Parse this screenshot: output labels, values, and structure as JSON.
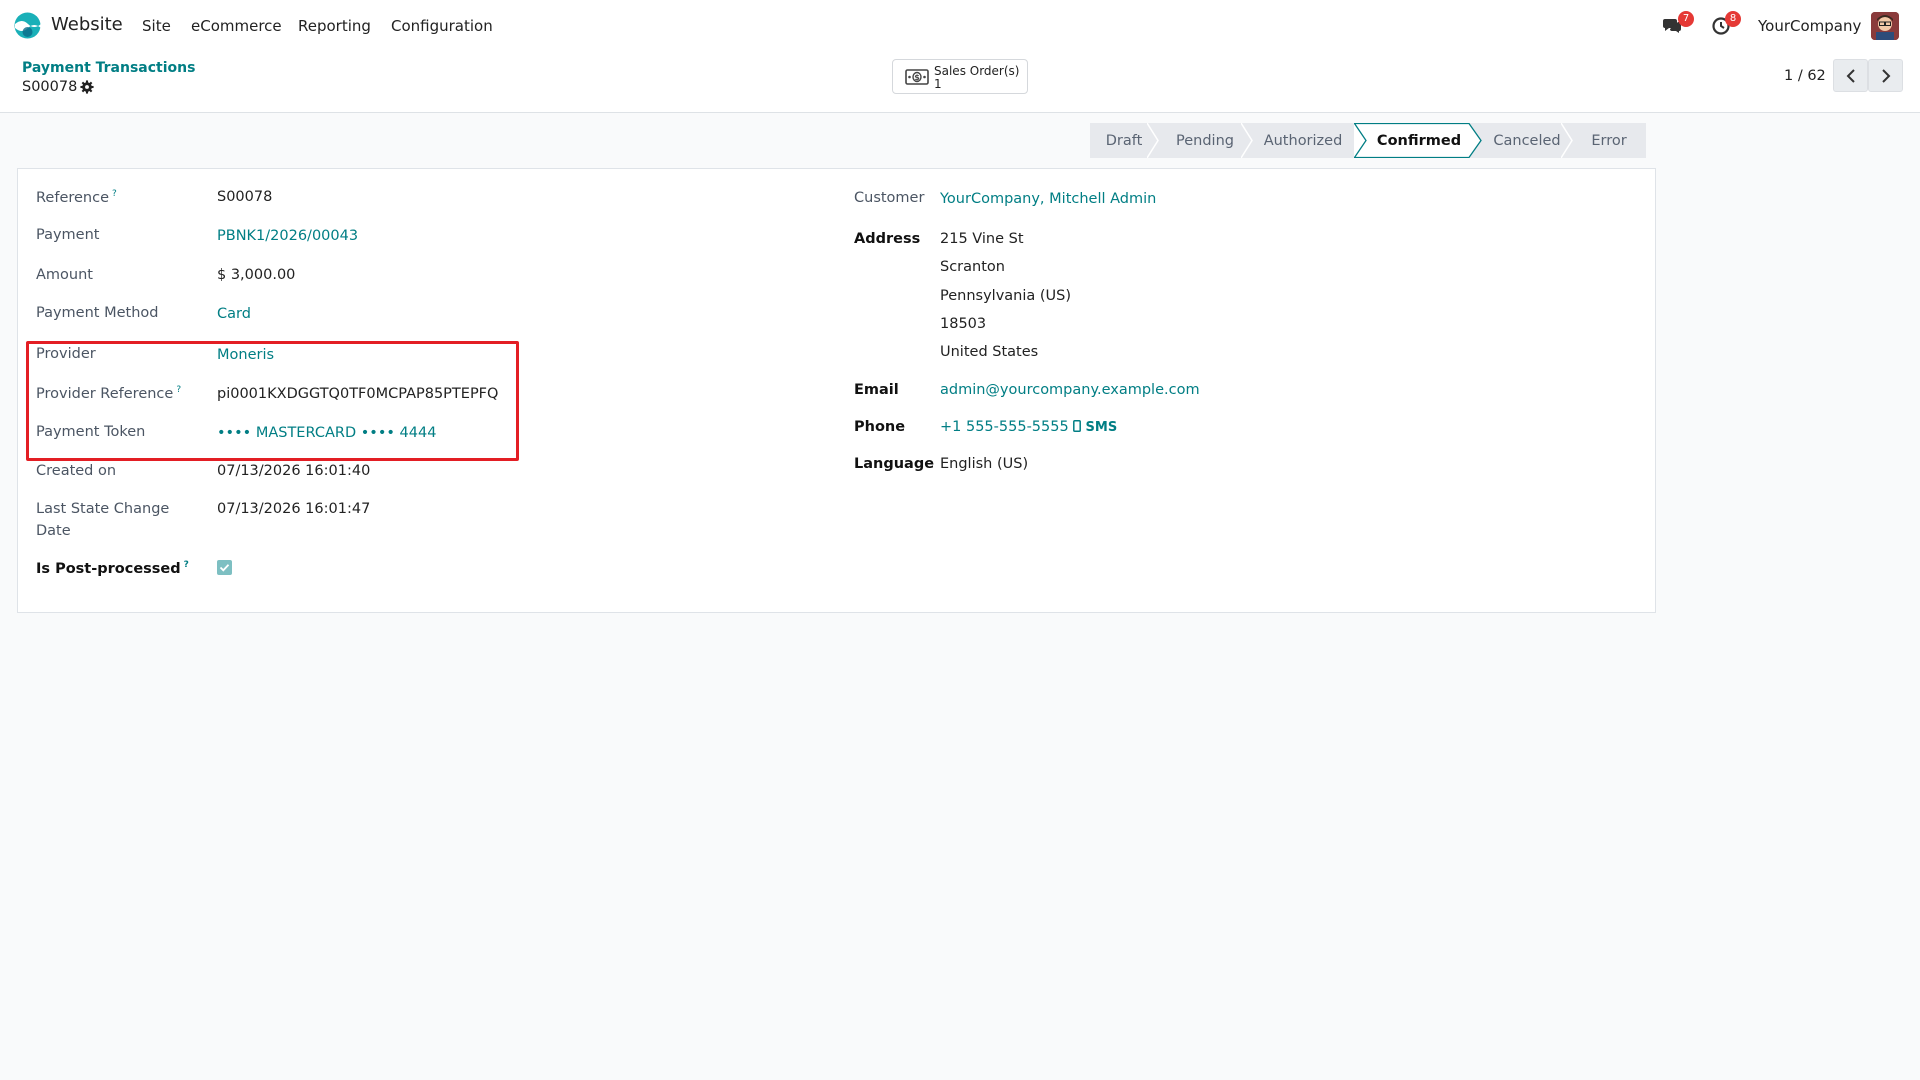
{
  "nav": {
    "app_name": "Website",
    "menu": [
      "Site",
      "eCommerce",
      "Reporting",
      "Configuration"
    ],
    "messages_count": "7",
    "activities_count": "8",
    "company": "YourCompany"
  },
  "control_panel": {
    "breadcrumb": "Payment Transactions",
    "record_name": "S00078",
    "smart_button": {
      "label": "Sales Order(s)",
      "count": "1",
      "icon": "money-icon"
    },
    "pager": "1 / 62"
  },
  "statusbar": {
    "stages": [
      "Draft",
      "Pending",
      "Authorized",
      "Confirmed",
      "Canceled",
      "Error"
    ],
    "active": "Confirmed"
  },
  "form": {
    "left": {
      "reference_label": "Reference",
      "reference": "S00078",
      "payment_label": "Payment",
      "payment": "PBNK1/2026/00043",
      "amount_label": "Amount",
      "amount": "$ 3,000.00",
      "payment_method_label": "Payment Method",
      "payment_method": "Card",
      "provider_label": "Provider",
      "provider": "Moneris",
      "provider_reference_label": "Provider Reference",
      "provider_reference": "pi0001KXDGGTQ0TF0MCPAP85PTEPFQ",
      "payment_token_label": "Payment Token",
      "payment_token": "•••• MASTERCARD •••• 4444",
      "created_on_label": "Created on",
      "created_on": "07/13/2026 16:01:40",
      "last_state_change_label_1": "Last State Change",
      "last_state_change_label_2": "Date",
      "last_state_change": "07/13/2026 16:01:47",
      "is_post_processed_label": "Is Post-processed",
      "is_post_processed": true
    },
    "right": {
      "customer_label": "Customer",
      "customer": "YourCompany, Mitchell Admin",
      "address_label": "Address",
      "address_lines": [
        "215 Vine St",
        "Scranton",
        "Pennsylvania (US)",
        "18503",
        "United States"
      ],
      "email_label": "Email",
      "email": "admin@yourcompany.example.com",
      "phone_label": "Phone",
      "phone": "+1 555-555-5555",
      "sms": "SMS",
      "language_label": "Language",
      "language": "English (US)"
    },
    "help_marker": "?"
  },
  "colors": {
    "accent": "#017e84",
    "highlight": "#e31e24",
    "badge": "#e53935"
  }
}
